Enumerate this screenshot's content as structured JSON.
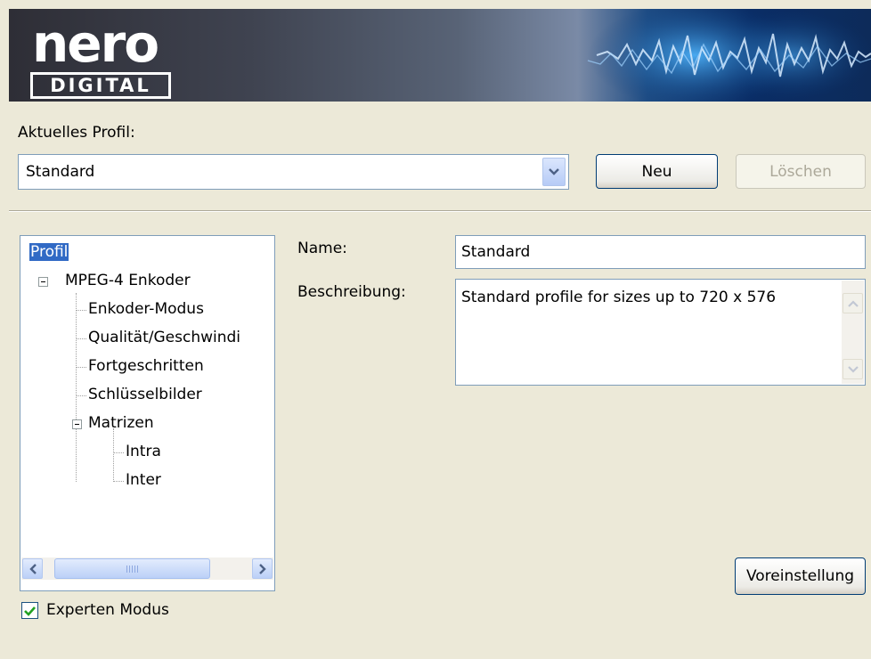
{
  "banner": {
    "logo_top": "nero",
    "logo_bottom": "DIGITAL"
  },
  "profile": {
    "label": "Aktuelles Profil:",
    "selected": "Standard",
    "new_button": "Neu",
    "delete_button": "Löschen"
  },
  "tree": {
    "items": [
      {
        "label": "Profil",
        "selected": true
      },
      {
        "label": "MPEG-4 Enkoder",
        "expanded": true
      },
      {
        "label": "Enkoder-Modus"
      },
      {
        "label": "Qualität/Geschwindi"
      },
      {
        "label": "Fortgeschritten"
      },
      {
        "label": "Schlüsselbilder"
      },
      {
        "label": "Matrizen",
        "expanded": true
      },
      {
        "label": "Intra"
      },
      {
        "label": "Inter"
      }
    ]
  },
  "form": {
    "name_label": "Name:",
    "name_value": "Standard",
    "description_label": "Beschreibung:",
    "description_value": "Standard profile for sizes up to 720 x 576"
  },
  "expert_mode": {
    "label": "Experten Modus",
    "checked": true
  },
  "defaults_button": "Voreinstellung",
  "colors": {
    "selection": "#316ac5",
    "window_bg": "#ece9d8",
    "border_blue": "#7f9db9",
    "check_green": "#21a121"
  }
}
